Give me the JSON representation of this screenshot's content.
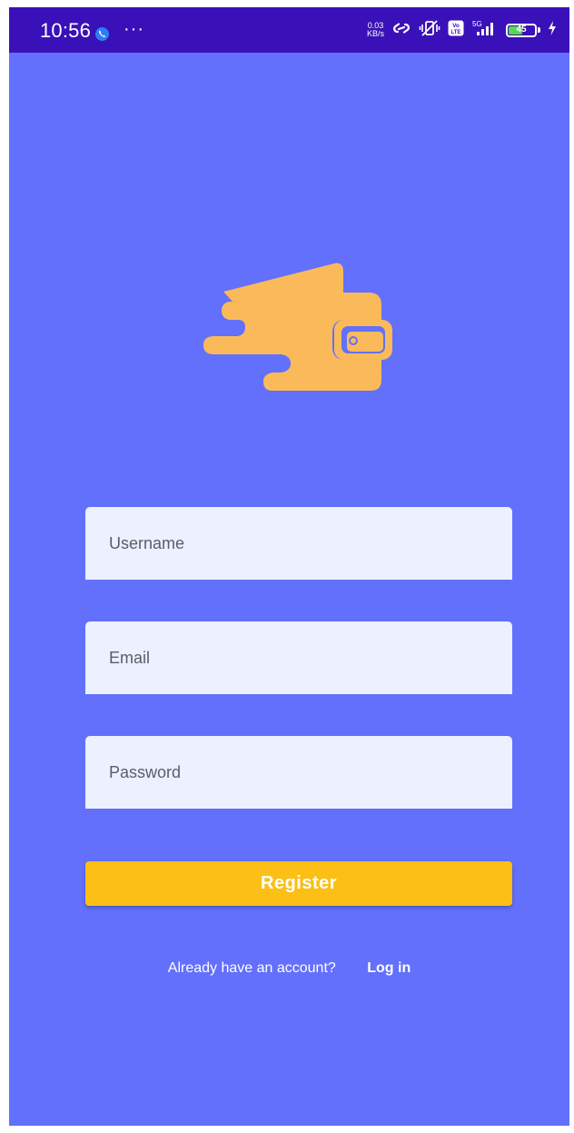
{
  "status_bar": {
    "time": "10:56",
    "more": "···",
    "net_speed_value": "0.03",
    "net_speed_unit": "KB/s",
    "network_label": "5G",
    "volte_label": "Vo LTE",
    "battery_level": "45",
    "icons": [
      "call-icon",
      "hotspot-link-icon",
      "vibrate-icon",
      "volte-icon",
      "signal-icon",
      "battery-icon",
      "charging-icon"
    ]
  },
  "app": {
    "logo_icon": "wallet-icon",
    "logo_color": "#fbba5a",
    "background_color": "#6270fc",
    "accent_color": "#fbbf16"
  },
  "form": {
    "username_placeholder": "Username",
    "username_value": "",
    "email_placeholder": "Email",
    "email_value": "",
    "password_placeholder": "Password",
    "password_value": "",
    "register_label": "Register"
  },
  "footer": {
    "prompt": "Already have an account?",
    "login_label": "Log in"
  }
}
